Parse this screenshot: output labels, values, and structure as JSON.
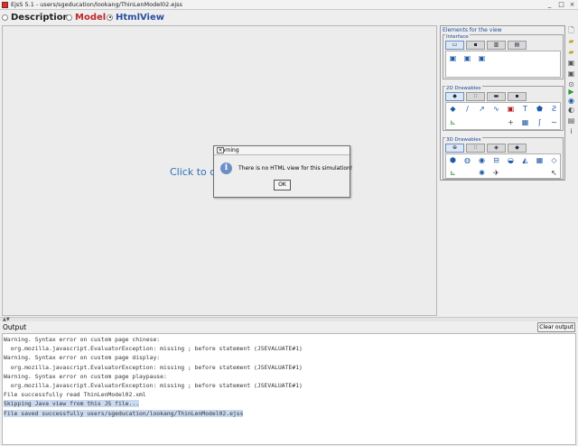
{
  "window": {
    "title": "EjsS 5.1 - users/sgeducation/lookang/ThinLenModel02.ejss",
    "min": "_",
    "max": "□",
    "close": "×"
  },
  "modes": [
    {
      "label": "Description",
      "selected": false,
      "color": "#1f1f1f"
    },
    {
      "label": "Model",
      "selected": false,
      "color": "#c0282a"
    },
    {
      "label": "HtmlView",
      "selected": true,
      "color": "#2a4fa0"
    }
  ],
  "main": {
    "placeholder": "Click to create"
  },
  "elements_panel": {
    "header": "Elements for the view",
    "groups": [
      {
        "label": "Interface",
        "tab_icons": [
          "view-tab-icon",
          "panel-tab-icon",
          "chart-tab-icon",
          "table-tab-icon"
        ]
      },
      {
        "label": "2D Drawables"
      },
      {
        "label": "3D Drawables"
      }
    ]
  },
  "dialog": {
    "title": "Warning",
    "message": "There is no HTML view for this simulation!",
    "ok": "OK",
    "info_glyph": "i",
    "close": "×"
  },
  "output": {
    "label": "Output",
    "clear_label": "Clear output",
    "lines": [
      "Warning. Syntax error on custom page chinese:",
      "  org.mozilla.javascript.EvaluatorException: missing ; before statement (JSEVALUATE#1)",
      "Warning. Syntax error on custom page display:",
      "  org.mozilla.javascript.EvaluatorException: missing ; before statement (JSEVALUATE#1)",
      "Warning. Syntax error on custom page playpause:",
      "  org.mozilla.javascript.EvaluatorException: missing ; before statement (JSEVALUATE#1)",
      "File successfully read ThinLenModel02.xml",
      "Skipping Java view from this JS file...",
      "File saved successfully users/sgeducation/lookang/ThinLenModel02.ejss"
    ],
    "highlighted": [
      7,
      8
    ]
  },
  "colors": {
    "accent": "#2f6fb8",
    "panel_label": "#1a4c96",
    "highlight": "#c9d9f0"
  }
}
